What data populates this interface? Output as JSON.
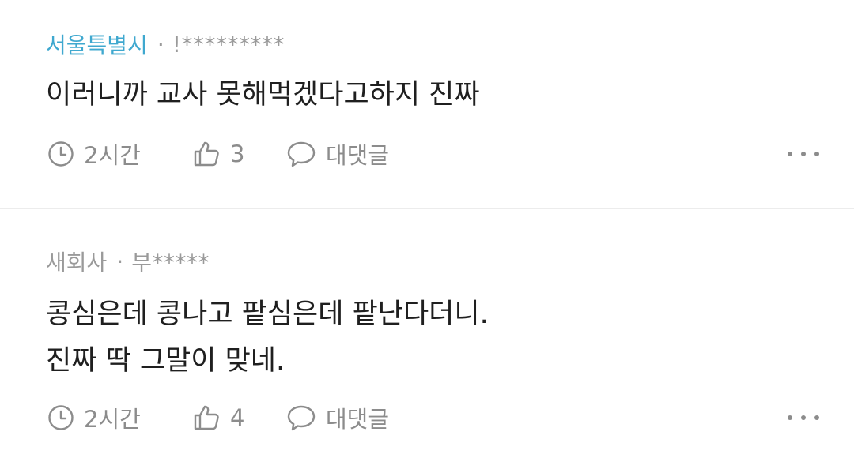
{
  "comments": [
    {
      "region": "서울특별시",
      "separator": "·",
      "author": "!*********",
      "text": "이러니까 교사 못해먹겠다고하지 진짜",
      "time": "2시간",
      "likes": "3",
      "reply_label": "대댓글"
    },
    {
      "region": "새회사",
      "separator": "·",
      "author": "부*****",
      "text": "콩심은데 콩나고 팥심은데 팥난다더니.\n진짜 딱 그말이 맞네.",
      "time": "2시간",
      "likes": "4",
      "reply_label": "대댓글"
    }
  ],
  "colors": {
    "region_highlight": "#3fa8cf",
    "meta_gray": "#9a9a9a",
    "text": "#1f1f1f",
    "icon_gray": "#8c8c8c",
    "divider": "#ececec"
  },
  "icons": [
    "clock-icon",
    "thumbs-up-icon",
    "chat-bubble-icon",
    "more-icon"
  ]
}
